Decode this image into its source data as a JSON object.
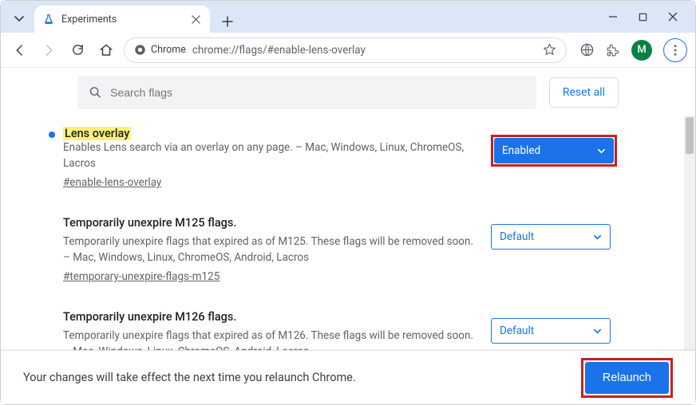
{
  "window": {
    "tab_title": "Experiments",
    "avatar_initial": "M"
  },
  "toolbar": {
    "chip_label": "Chrome",
    "url": "chrome://flags/#enable-lens-overlay"
  },
  "search": {
    "placeholder": "Search flags",
    "reset_label": "Reset all"
  },
  "flags": [
    {
      "title": "Lens overlay",
      "highlight": true,
      "modified": true,
      "desc": "Enables Lens search via an overlay on any page. – Mac, Windows, Linux, ChromeOS, Lacros",
      "anchor": "#enable-lens-overlay",
      "value": "Enabled",
      "enabled_style": true,
      "red_outline": true
    },
    {
      "title": "Temporarily unexpire M125 flags.",
      "highlight": false,
      "modified": false,
      "desc": "Temporarily unexpire flags that expired as of M125. These flags will be removed soon. – Mac, Windows, Linux, ChromeOS, Android, Lacros",
      "anchor": "#temporary-unexpire-flags-m125",
      "value": "Default",
      "enabled_style": false,
      "red_outline": false
    },
    {
      "title": "Temporarily unexpire M126 flags.",
      "highlight": false,
      "modified": false,
      "desc": "Temporarily unexpire flags that expired as of M126. These flags will be removed soon. – Mac, Windows, Linux, ChromeOS, Android, Lacros",
      "anchor": "",
      "value": "Default",
      "enabled_style": false,
      "red_outline": false
    }
  ],
  "footer": {
    "message": "Your changes will take effect the next time you relaunch Chrome.",
    "button": "Relaunch"
  }
}
